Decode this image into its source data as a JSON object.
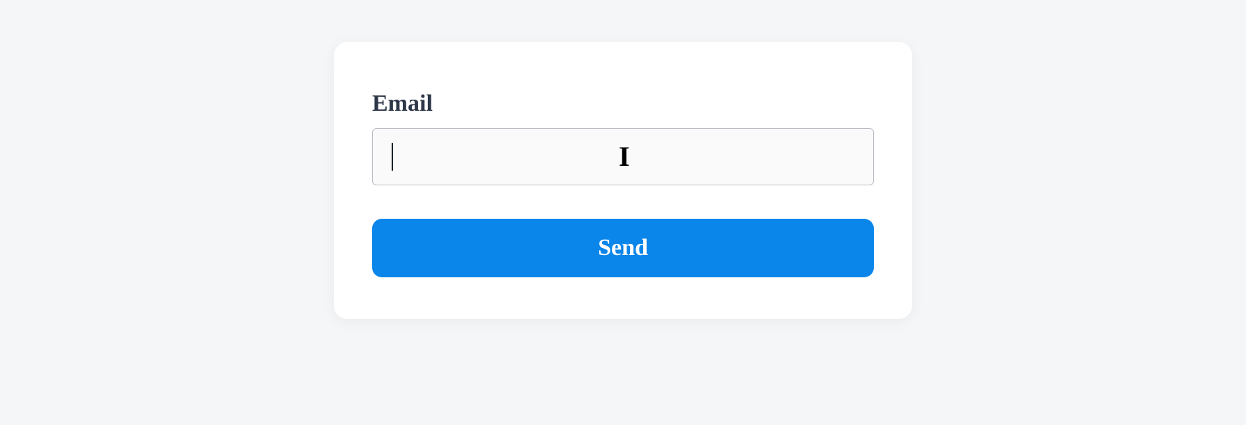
{
  "form": {
    "email_label": "Email",
    "email_value": "",
    "send_label": "Send"
  },
  "colors": {
    "accent": "#0a85ea",
    "text": "#2d3748",
    "background": "#f5f6f7"
  }
}
